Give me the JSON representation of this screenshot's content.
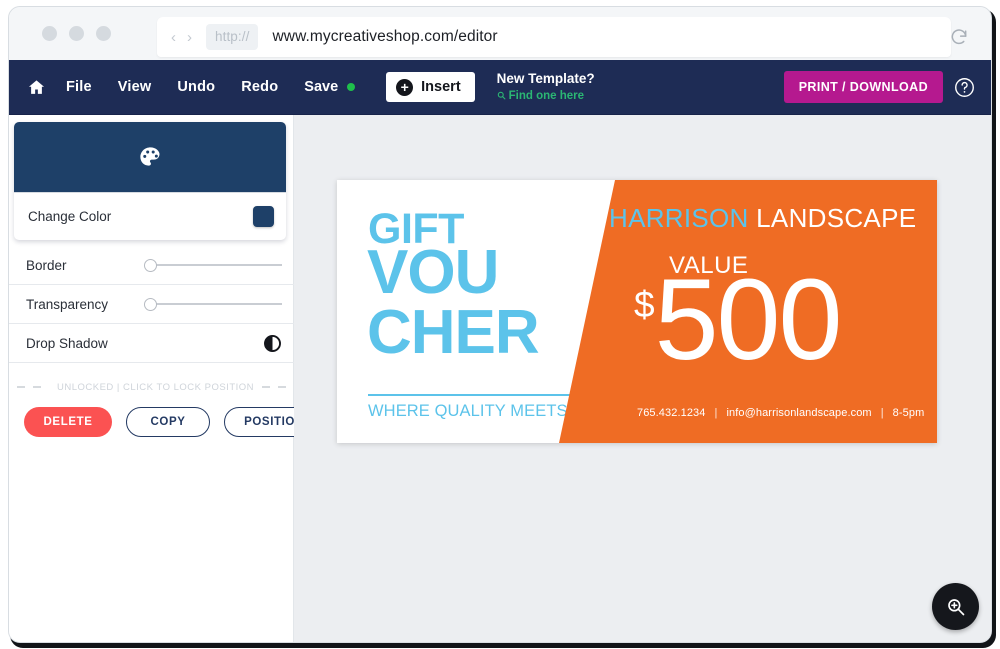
{
  "browser": {
    "url": "www.mycreativeshop.com/editor",
    "scheme_chip": "http://",
    "back_arrow": "‹",
    "forward_arrow": "›",
    "reload_icon": "reload-icon"
  },
  "toolbar": {
    "home_icon": "home-icon",
    "menu": [
      "File",
      "View",
      "Undo",
      "Redo"
    ],
    "save_label": "Save",
    "save_status_color": "#1ec04b",
    "insert_label": "Insert",
    "insert_icon": "plus-circle-icon",
    "template_title": "New Template?",
    "template_link": "Find one here",
    "template_link_icon": "search-icon",
    "print_label": "PRINT / DOWNLOAD",
    "print_color": "#b5198f",
    "help_icon": "question-circle-icon"
  },
  "sidebar": {
    "color_card": {
      "header_icon": "palette-icon",
      "header_color": "#1e4068",
      "label": "Change Color",
      "swatch_color": "#1e4068"
    },
    "options": [
      {
        "label": "Border",
        "control": "slider",
        "value": 0
      },
      {
        "label": "Transparency",
        "control": "slider",
        "value": 0
      },
      {
        "label": "Drop Shadow",
        "control": "toggle-icon",
        "icon": "contrast-icon"
      }
    ],
    "lock_row": {
      "icon": "lock-icon",
      "text": "UNLOCKED | CLICK TO LOCK POSITION"
    },
    "actions": [
      {
        "label": "DELETE",
        "style": "filled",
        "color": "#fb5252"
      },
      {
        "label": "COPY",
        "style": "outline",
        "color": "#243a63"
      },
      {
        "label": "POSITION",
        "style": "outline",
        "color": "#243a63"
      }
    ]
  },
  "canvas": {
    "zoom_fab_icon": "zoom-in-icon",
    "voucher": {
      "bg_color": "#ffffff",
      "accent_color": "#ef6c24",
      "blue_color": "#5cc3ea",
      "title_line1": "GIFT",
      "title_line2": "VOU",
      "title_line3": "CHER",
      "tagline": "WHERE QUALITY MEETS VALUE",
      "brand_first": "HARRISON",
      "brand_second": " LANDSCAPE",
      "value_label": "VALUE",
      "currency": "$",
      "amount": "500",
      "footer_phone": "765.432.1234",
      "footer_email": "info@harrisonlandscape.com",
      "footer_hours": "8-5pm",
      "footer_separator": "|"
    }
  }
}
